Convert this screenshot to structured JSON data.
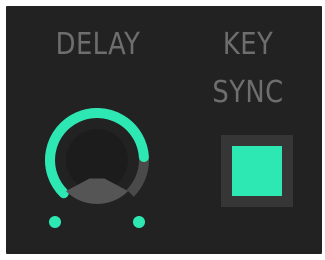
{
  "delay": {
    "label": "DELAY",
    "value_fraction": 0.82
  },
  "key_sync": {
    "label_line1": "KEY",
    "label_line2": "SYNC",
    "enabled": true
  },
  "colors": {
    "accent": "#2ee8b4",
    "panel_background": "#222222",
    "label_text": "#6e6e6e",
    "knob_track": "#4a4a4a",
    "toggle_background": "#363636"
  }
}
